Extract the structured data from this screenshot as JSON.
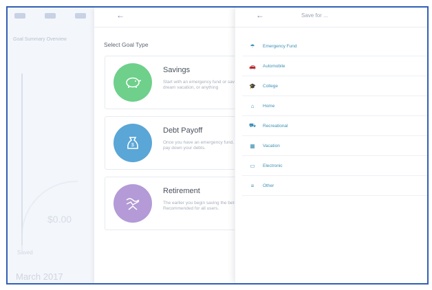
{
  "background": {
    "subtitle": "Goal Summary Overview",
    "value": "$0.00",
    "note": "Saved",
    "month": "March 2017"
  },
  "left_panel": {
    "back": "←",
    "section_title": "Select Goal Type",
    "goals": [
      {
        "title": "Savings",
        "desc1": "Start with an emergency fund or save for a",
        "desc2": "dream vacation, or anything",
        "color": "#6ed08a",
        "icon": "piggy-bank-icon",
        "glyph": "🐖"
      },
      {
        "title": "Debt Payoff",
        "desc1": "Once you have an emergency fund, start to",
        "desc2": "pay down your debts.",
        "color": "#5aa6d6",
        "icon": "money-bag-icon",
        "glyph": "$"
      },
      {
        "title": "Retirement",
        "desc1": "The earlier you begin saving the better.",
        "desc2": "Recommended for all users.",
        "color": "#b49ad6",
        "icon": "retirement-icon",
        "glyph": "⇄"
      }
    ]
  },
  "right_panel": {
    "back": "←",
    "title": "Save for ...",
    "accent": "#3c8fb4",
    "categories": [
      {
        "label": "Emergency Fund",
        "icon": "umbrella-icon",
        "glyph": "☂"
      },
      {
        "label": "Automobile",
        "icon": "car-icon",
        "glyph": "🚗"
      },
      {
        "label": "College",
        "icon": "graduation-cap-icon",
        "glyph": "🎓"
      },
      {
        "label": "Home",
        "icon": "home-icon",
        "glyph": "⌂"
      },
      {
        "label": "Recreational",
        "icon": "rv-icon",
        "glyph": "⛟"
      },
      {
        "label": "Vacation",
        "icon": "suitcase-icon",
        "glyph": "▦"
      },
      {
        "label": "Electronic",
        "icon": "monitor-icon",
        "glyph": "▭"
      },
      {
        "label": "Other",
        "icon": "other-icon",
        "glyph": "≡"
      }
    ]
  }
}
